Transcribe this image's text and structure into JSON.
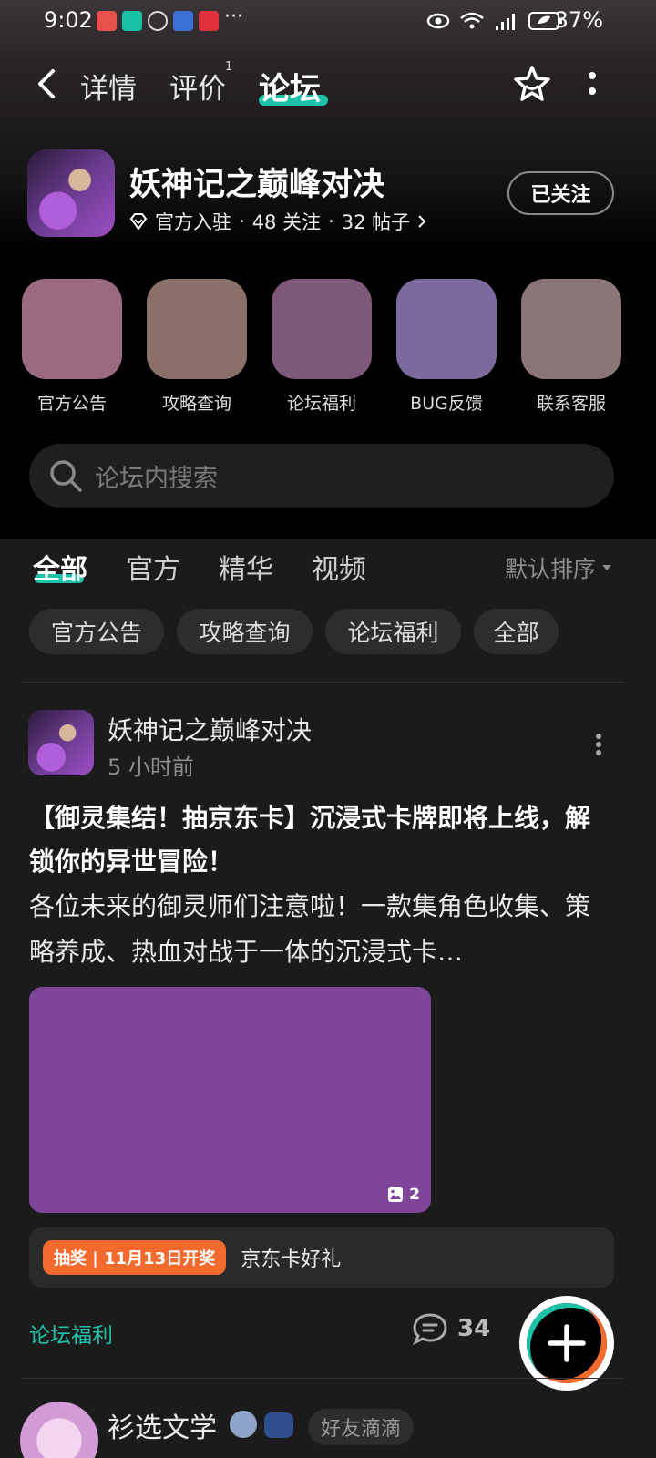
{
  "status_bar": {
    "time": "9:02",
    "battery": "37%"
  },
  "nav": {
    "tabs": [
      {
        "label": "详情"
      },
      {
        "label": "评价",
        "badge": "1"
      },
      {
        "label": "论坛"
      }
    ],
    "active_tab": "论坛",
    "accent": "#1cc3a8"
  },
  "game": {
    "title": "妖神记之巅峰对决",
    "official": "官方入驻",
    "followers": "48 关注",
    "posts": "32 帖子",
    "follow_button": "已关注"
  },
  "shortcuts": [
    {
      "label": "官方公告",
      "color": "#9a6a80"
    },
    {
      "label": "攻略查询",
      "color": "#8a7068"
    },
    {
      "label": "论坛福利",
      "color": "#7d5878"
    },
    {
      "label": "BUG反馈",
      "color": "#7c6a9e"
    },
    {
      "label": "联系客服",
      "color": "#8a7678"
    }
  ],
  "search": {
    "placeholder": "论坛内搜索"
  },
  "filter_tabs": [
    "全部",
    "官方",
    "精华",
    "视频"
  ],
  "sort_label": "默认排序",
  "chips": [
    "官方公告",
    "攻略查询",
    "论坛福利",
    "全部"
  ],
  "post": {
    "author": "妖神记之巅峰对决",
    "time": "5 小时前",
    "title": "【御灵集结！抽京东卡】沉浸式卡牌即将上线，解锁你的异世冒险！",
    "body": "各位未来的御灵师们注意啦！一款集角色收集、策略养成、热血对战于一体的沉浸式卡…",
    "image_count": "2",
    "lottery_tag": "抽奖 | 11月13日开奖",
    "lottery_prize": "京东卡好礼",
    "tag": "论坛福利",
    "comments": "34"
  },
  "next_post": {
    "author": "衫选文学",
    "tag": "好友滴滴"
  }
}
